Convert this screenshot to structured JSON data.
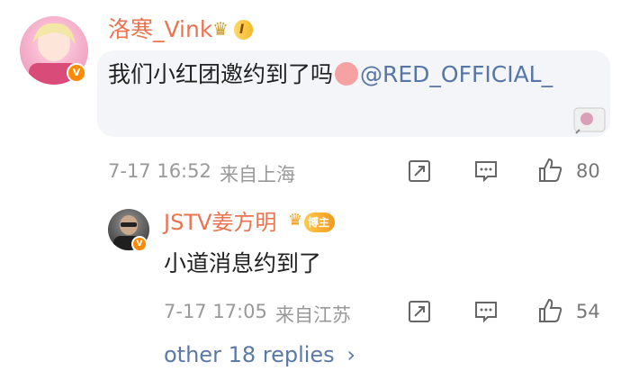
{
  "comment1": {
    "username": "洛寒_Vink",
    "level_label": "I",
    "text": "我们小红团邀约到了吗",
    "mention": "@RED_OFFICIAL_",
    "time": "7-17 16:52",
    "location": "来自上海",
    "likes": "80"
  },
  "reply1": {
    "username": "JSTV姜方明",
    "badge_label": "博主",
    "text": "小道消息约到了",
    "time": "7-17 17:05",
    "location": "来自江苏",
    "likes": "54"
  },
  "more_replies": "other 18 replies",
  "colors": {
    "username": "#eb7350",
    "link": "#5576a7",
    "meta": "#999999"
  }
}
